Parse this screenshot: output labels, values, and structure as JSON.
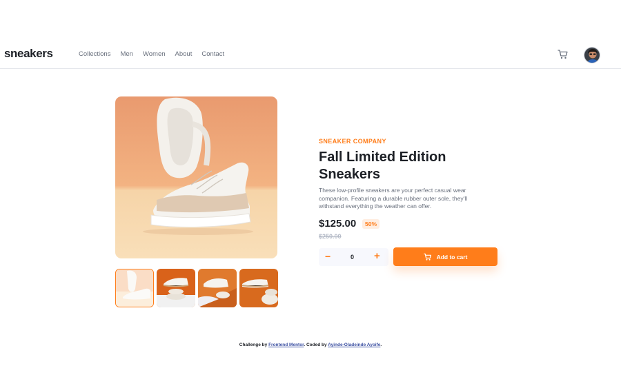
{
  "header": {
    "logo": "sneakers",
    "nav": [
      "Collections",
      "Men",
      "Women",
      "About",
      "Contact"
    ],
    "icons": {
      "cart": "cart-icon",
      "avatar": "user-avatar"
    }
  },
  "product": {
    "company": "SNEAKER COMPANY",
    "title": "Fall Limited Edition Sneakers",
    "description": "These low-profile sneakers are your perfect casual wear companion. Featuring a durable rubber outer sole, they'll withstand everything the weather can offer.",
    "price": "$125.00",
    "discount": "50%",
    "old_price": "$250.00",
    "quantity": "0",
    "add_to_cart": "Add to cart"
  },
  "gallery": {
    "thumbnail_count": 4,
    "selected_index": 0
  },
  "footer": {
    "prefix": "Challenge by",
    "challenge_link": "Frontend Mentor",
    "middle": ". Coded by",
    "author_link": "Ayinde-Oladeinde Ayoife",
    "suffix": "."
  },
  "colors": {
    "accent": "#ff7d1a",
    "accent_pale": "#ffede0",
    "text_dark": "#1d2026",
    "text_gray": "#69707d",
    "link": "#3e52a3"
  }
}
